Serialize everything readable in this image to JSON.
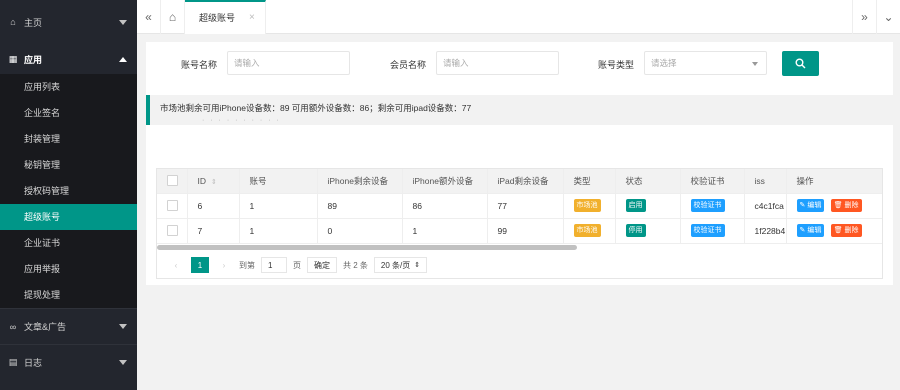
{
  "sidebar": {
    "home": {
      "label": "主页",
      "icon": "home-icon"
    },
    "app": {
      "label": "应用",
      "icon": "app-grid-icon"
    },
    "items": [
      {
        "label": "应用列表"
      },
      {
        "label": "企业签名"
      },
      {
        "label": "封装管理"
      },
      {
        "label": "秘钥管理"
      },
      {
        "label": "授权码管理"
      },
      {
        "label": "超级账号",
        "active": true
      },
      {
        "label": "企业证书"
      },
      {
        "label": "应用举报"
      },
      {
        "label": "提现处理"
      }
    ],
    "articles": {
      "label": "文章&广告",
      "icon": "link-icon"
    },
    "log": {
      "label": "日志",
      "icon": "log-icon"
    }
  },
  "tabbar": {
    "back_icon": "double-chevron-left-icon",
    "home_icon": "home-icon",
    "active_tab": "超级账号",
    "close_glyph": "×",
    "forward_icon": "double-chevron-right-icon",
    "dropdown_icon": "chevron-down-icon"
  },
  "search": {
    "account_label": "账号名称",
    "account_placeholder": "请输入",
    "member_label": "会员名称",
    "member_placeholder": "请输入",
    "type_label": "账号类型",
    "type_placeholder": "请选择",
    "search_icon": "search-icon"
  },
  "notice": {
    "text": "市场池剩余可用iPhone设备数：89 可用额外设备数：86；剩余可用ipad设备数：77",
    "overflow_text": "·  ·  ·  ·  ·  ·  ·  ·  ·  ·"
  },
  "table": {
    "headers": [
      "ID",
      "账号",
      "iPhone剩余设备",
      "iPhone额外设备",
      "iPad剩余设备",
      "类型",
      "状态",
      "校验证书",
      "iss",
      "操作"
    ],
    "rows": [
      {
        "id": "6",
        "account": "1",
        "iphone_left": "89",
        "iphone_extra": "86",
        "ipad_left": "77",
        "type": "市场池",
        "status": "启用",
        "cert": "校验证书",
        "iss": "c4c1fca",
        "edit": "编辑",
        "delete": "删除"
      },
      {
        "id": "7",
        "account": "1",
        "iphone_left": "0",
        "iphone_extra": "1",
        "ipad_left": "99",
        "type": "市场池",
        "status": "停用",
        "cert": "校验证书",
        "iss": "1f228b4",
        "edit": "编辑",
        "delete": "删除"
      }
    ]
  },
  "pager": {
    "prev": "‹",
    "current": "1",
    "next": "›",
    "goto_label": "到第",
    "goto_value": "1",
    "page_suffix": "页",
    "confirm": "确定",
    "total": "共 2 条",
    "page_size": "20 条/页"
  },
  "colors": {
    "accent": "#009688",
    "sidebar": "#23262e",
    "warning": "#f1b02d",
    "info": "#1e9fff",
    "danger": "#ff5722"
  }
}
